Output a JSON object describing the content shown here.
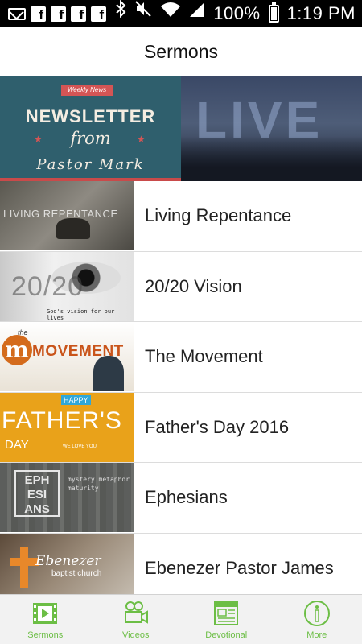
{
  "status_bar": {
    "battery": "100%",
    "time": "1:19 PM",
    "icons": [
      "mail-icon",
      "facebook-icon",
      "facebook-icon",
      "facebook-icon",
      "facebook-icon",
      "bluetooth-icon",
      "mute-icon",
      "wifi-icon",
      "signal-icon",
      "battery-icon"
    ]
  },
  "header": {
    "title": "Sermons"
  },
  "banner": {
    "newsletter": {
      "tag": "Weekly News",
      "line1": "NEWSLETTER",
      "line2": "from",
      "line3": "Pastor Mark"
    },
    "live": {
      "word": "LIVE"
    }
  },
  "sermons": [
    {
      "title": "Living Repentance",
      "thumb_text": "LIVING REPENTANCE"
    },
    {
      "title": "20/20 Vision",
      "thumb_text": "20/20",
      "thumb_subtext": "God's vision for our lives"
    },
    {
      "title": "The Movement",
      "thumb_text": "MOVEMENT",
      "thumb_letter": "m",
      "thumb_small": "the"
    },
    {
      "title": "Father's Day 2016",
      "thumb_text": "FATHER'S",
      "thumb_day": "DAY",
      "thumb_happy": "HAPPY",
      "thumb_love": "WE LOVE YOU"
    },
    {
      "title": "Ephesians",
      "thumb_box": "EPH ESI ANS",
      "thumb_words": "mystery metaphor maturity"
    },
    {
      "title": "Ebenezer Pastor James",
      "thumb_text": "Ebenezer",
      "thumb_sub": "baptist church"
    }
  ],
  "tabs": [
    {
      "label": "Sermons",
      "icon": "film-icon"
    },
    {
      "label": "Videos",
      "icon": "video-camera-icon"
    },
    {
      "label": "Devotional",
      "icon": "document-icon"
    },
    {
      "label": "More",
      "icon": "info-icon"
    }
  ],
  "colors": {
    "accent": "#6cbe45",
    "status_bar": "#000000"
  }
}
